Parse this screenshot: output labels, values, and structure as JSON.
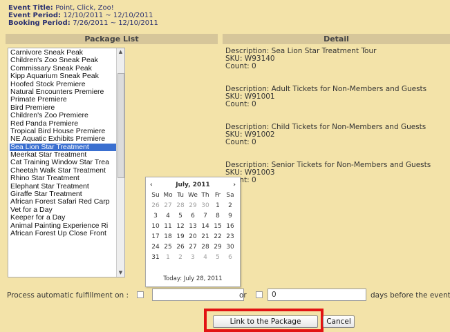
{
  "event": {
    "title_label": "Event Title:",
    "title_value": "Point, Click, Zoo!",
    "period_label": "Event Period:",
    "period_value": "12/10/2011 ~ 12/10/2011",
    "booking_label": "Booking Period:",
    "booking_value": "7/26/2011 ~ 12/10/2011"
  },
  "headers": {
    "package_list": "Package List",
    "detail": "Detail"
  },
  "packages": [
    "Carnivore Sneak Peak",
    "Children's Zoo Sneak Peak",
    "Commissary Sneak Peak",
    "Kipp Aquarium Sneak Peak",
    "Hoofed Stock Premiere",
    "Natural Encounters Premiere",
    "Primate Premiere",
    "Bird Premiere",
    "Children's Zoo Premiere",
    "Red Panda Premiere",
    "Tropical Bird House Premiere",
    "NE Aquatic Exhibits Premiere",
    "Sea Lion Star Treatment",
    "Meerkat Star Treatment",
    "Cat Training Window Star Trea",
    "Cheetah Walk Star Treatment",
    "Rhino Star Treatment",
    "Elephant Star Treatment",
    "Giraffe Star Treatment",
    "African Forest Safari Red Carp",
    "Vet for a Day",
    "Keeper for a Day",
    "Animal Painting Experience Ri",
    "African Forest Up Close Front"
  ],
  "selected_package": "Sea Lion Star Treatment",
  "details": [
    {
      "description": "Description: Sea Lion Star Treatment Tour",
      "sku": "SKU: W93140",
      "count": "Count: 0"
    },
    {
      "description": "Description: Adult Tickets for Non-Members and Guests",
      "sku": "SKU: W91001",
      "count": "Count: 0"
    },
    {
      "description": "Description: Child Tickets for Non-Members and Guests",
      "sku": "SKU: W91002",
      "count": "Count: 0"
    },
    {
      "description": "Description: Senior Tickets for Non-Members and Guests",
      "sku": "SKU: W91003",
      "count": "Count: 0"
    }
  ],
  "calendar": {
    "month": "July, 2011",
    "prev": "‹",
    "next": "›",
    "weekdays": [
      "Su",
      "Mo",
      "Tu",
      "We",
      "Th",
      "Fr",
      "Sa"
    ],
    "days": [
      [
        "26",
        "27",
        "28",
        "29",
        "30",
        "1",
        "2"
      ],
      [
        "3",
        "4",
        "5",
        "6",
        "7",
        "8",
        "9"
      ],
      [
        "10",
        "11",
        "12",
        "13",
        "14",
        "15",
        "16"
      ],
      [
        "17",
        "18",
        "19",
        "20",
        "21",
        "22",
        "23"
      ],
      [
        "24",
        "25",
        "26",
        "27",
        "28",
        "29",
        "30"
      ],
      [
        "31",
        "1",
        "2",
        "3",
        "4",
        "5",
        "6"
      ]
    ],
    "today": "Today: July 28, 2011"
  },
  "fulfillment": {
    "label": "Process automatic fulfillment on :",
    "or": "or",
    "days_value": "0",
    "days_label": "days before the event"
  },
  "buttons": {
    "link": "Link to the Package",
    "cancel": "Cancel"
  },
  "colors": {
    "background": "#f3e3a9",
    "selection": "#3a6fd0",
    "highlight": "#e21313"
  }
}
